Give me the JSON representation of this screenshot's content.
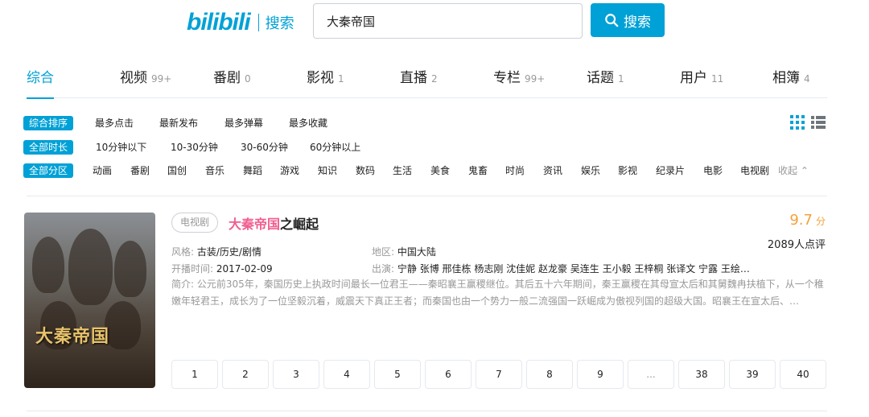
{
  "header": {
    "logo_text": "bilibili",
    "logo_sub": "搜索",
    "search_value": "大秦帝国",
    "search_button": "搜索"
  },
  "tabs": [
    {
      "label": "综合",
      "count": ""
    },
    {
      "label": "视频",
      "count": "99+"
    },
    {
      "label": "番剧",
      "count": "0"
    },
    {
      "label": "影视",
      "count": "1"
    },
    {
      "label": "直播",
      "count": "2"
    },
    {
      "label": "专栏",
      "count": "99+"
    },
    {
      "label": "话题",
      "count": "1"
    },
    {
      "label": "用户",
      "count": "11"
    },
    {
      "label": "相簿",
      "count": "4"
    }
  ],
  "filters": {
    "sort": {
      "chip": "综合排序",
      "options": [
        "最多点击",
        "最新发布",
        "最多弹幕",
        "最多收藏"
      ]
    },
    "duration": {
      "chip": "全部时长",
      "options": [
        "10分钟以下",
        "10-30分钟",
        "30-60分钟",
        "60分钟以上"
      ]
    },
    "zone": {
      "chip": "全部分区",
      "options": [
        "动画",
        "番剧",
        "国创",
        "音乐",
        "舞蹈",
        "游戏",
        "知识",
        "数码",
        "生活",
        "美食",
        "鬼畜",
        "时尚",
        "资讯",
        "娱乐",
        "影视",
        "纪录片",
        "电影",
        "电视剧"
      ],
      "fold": "收起"
    }
  },
  "result": {
    "type_badge": "电视剧",
    "title_highlight": "大秦帝国",
    "title_rest": "之崛起",
    "poster_text": "大秦帝国",
    "score": "9.7",
    "score_unit": "分",
    "reviews": "2089人点评",
    "style_key": "风格:",
    "style_val": "古装/历史/剧情",
    "region_key": "地区:",
    "region_val": "中国大陆",
    "date_key": "开播时间:",
    "date_val": "2017-02-09",
    "cast_key": "出演:",
    "cast_val": "宁静 张博 邢佳栋 杨志刚 沈佳妮 赵龙豪 吴连生 王小毅 王梓桐 张译文 宁露 王绘…",
    "desc": "简介: 公元前305年，秦国历史上执政时间最长一位君王——秦昭襄王赢稷继位。其后五十六年期间，秦王赢稷在其母宣太后和其舅魏冉扶植下，从一个稚嫩年轻君王，成长为了一位坚毅沉着，威震天下真正王者；而秦国也由一个势力一般二流强国一跃崛成为傲视列国的超级大国。昭襄王在宣太后、…"
  },
  "pagination": [
    "1",
    "2",
    "3",
    "4",
    "5",
    "6",
    "7",
    "8",
    "9",
    "...",
    "38",
    "39",
    "40"
  ],
  "colors": {
    "accent": "#00a1d6",
    "highlight": "#f25d8e",
    "score": "#f4a13b"
  }
}
